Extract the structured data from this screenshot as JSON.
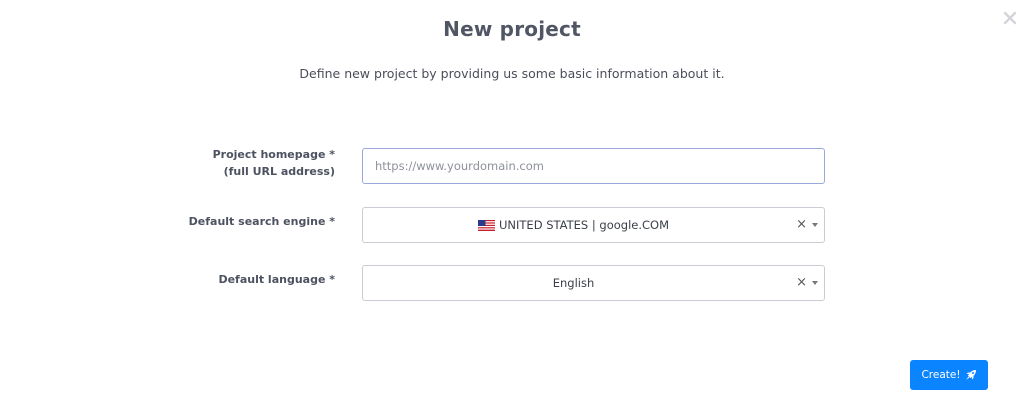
{
  "modal": {
    "title": "New project",
    "subtitle": "Define new project by providing us some basic information about it."
  },
  "form": {
    "homepage": {
      "label_line1": "Project homepage *",
      "label_line2": "(full URL address)",
      "placeholder": "https://www.yourdomain.com",
      "value": ""
    },
    "search_engine": {
      "label": "Default search engine *",
      "value": "UNITED STATES | google.COM",
      "flag_icon": "us-flag-icon"
    },
    "language": {
      "label": "Default language *",
      "value": "English"
    }
  },
  "actions": {
    "create_label": "Create!",
    "create_icon": "rocket-icon",
    "close_icon": "close-icon"
  },
  "colors": {
    "primary": "#0a84ff",
    "input_focus_border": "#9aa9d9",
    "select_border": "#c9ccd3",
    "title": "#505664"
  }
}
